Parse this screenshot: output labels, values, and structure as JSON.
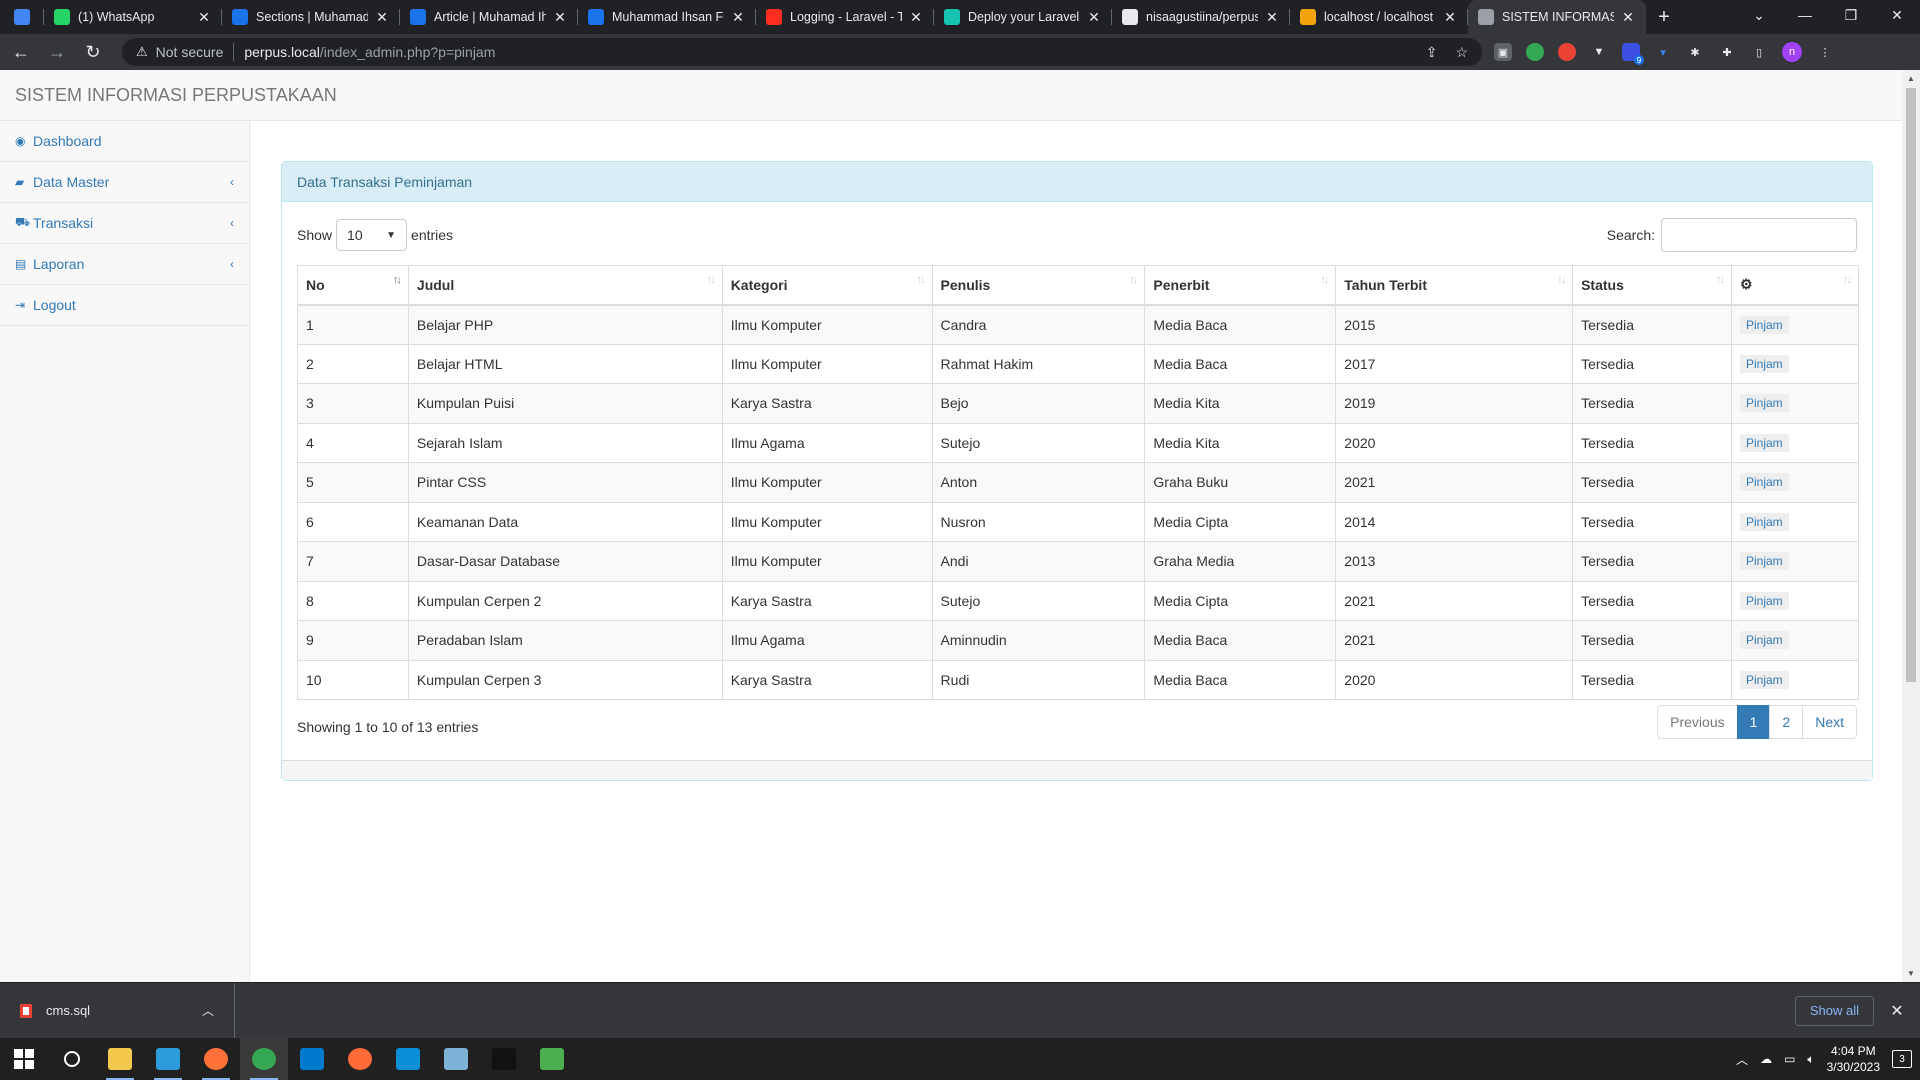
{
  "browser": {
    "tabs": [
      {
        "title": "",
        "icon": "pin-icon",
        "color": "#4285f4",
        "small": true
      },
      {
        "title": "(1) WhatsApp",
        "icon": "whatsapp-icon",
        "color": "#25d366"
      },
      {
        "title": "Sections | Muhamad",
        "icon": "edge-icon",
        "color": "#1a73e8"
      },
      {
        "title": "Article | Muhamad Ih",
        "icon": "edge-icon",
        "color": "#1a73e8"
      },
      {
        "title": "Muhammad Ihsan Fir",
        "icon": "letter-f-icon",
        "color": "#1a73e8"
      },
      {
        "title": "Logging - Laravel - Th",
        "icon": "laravel-icon",
        "color": "#ff2d20"
      },
      {
        "title": "Deploy your Laravel F",
        "icon": "fly-icon",
        "color": "#17c3b2"
      },
      {
        "title": "nisaagustiina/perpus",
        "icon": "github-icon",
        "color": "#e8eaed"
      },
      {
        "title": "localhost / localhost",
        "icon": "phpmyadmin-icon",
        "color": "#f0a30a"
      },
      {
        "title": "SISTEM INFORMASI P",
        "icon": "globe-icon",
        "color": "#9aa0a6",
        "active": true
      }
    ],
    "new_tab": "+",
    "address": {
      "security": "Not secure",
      "host": "perpus.local",
      "path": "/index_admin.php?p=pinjam"
    },
    "profile_initial": "n",
    "ext_badge": "9"
  },
  "app": {
    "brand": "SISTEM INFORMASI PERPUSTAKAAN",
    "sidebar": [
      {
        "label": "Dashboard",
        "icon": "dashboard-icon",
        "glyph": "◉",
        "expandable": false
      },
      {
        "label": "Data Master",
        "icon": "book-icon",
        "glyph": "▰",
        "expandable": true
      },
      {
        "label": "Transaksi",
        "icon": "cart-icon",
        "glyph": "⛟",
        "expandable": true
      },
      {
        "label": "Laporan",
        "icon": "list-icon",
        "glyph": "▤",
        "expandable": true
      },
      {
        "label": "Logout",
        "icon": "logout-icon",
        "glyph": "⇥",
        "expandable": false
      }
    ],
    "panel_title": "Data Transaksi Peminjaman",
    "length": {
      "show": "Show",
      "value": "10",
      "entries": "entries"
    },
    "search_label": "Search:",
    "search_value": "",
    "columns": [
      "No",
      "Judul",
      "Kategori",
      "Penulis",
      "Penerbit",
      "Tahun Terbit",
      "Status",
      ""
    ],
    "settings_column_icon": "gear-icon",
    "action_label": "Pinjam",
    "rows": [
      [
        "1",
        "Belajar PHP",
        "Ilmu Komputer",
        "Candra",
        "Media Baca",
        "2015",
        "Tersedia"
      ],
      [
        "2",
        "Belajar HTML",
        "Ilmu Komputer",
        "Rahmat Hakim",
        "Media Baca",
        "2017",
        "Tersedia"
      ],
      [
        "3",
        "Kumpulan Puisi",
        "Karya Sastra",
        "Bejo",
        "Media Kita",
        "2019",
        "Tersedia"
      ],
      [
        "4",
        "Sejarah Islam",
        "Ilmu Agama",
        "Sutejo",
        "Media Kita",
        "2020",
        "Tersedia"
      ],
      [
        "5",
        "Pintar CSS",
        "Ilmu Komputer",
        "Anton",
        "Graha Buku",
        "2021",
        "Tersedia"
      ],
      [
        "6",
        "Keamanan Data",
        "Ilmu Komputer",
        "Nusron",
        "Media Cipta",
        "2014",
        "Tersedia"
      ],
      [
        "7",
        "Dasar-Dasar Database",
        "Ilmu Komputer",
        "Andi",
        "Graha Media",
        "2013",
        "Tersedia"
      ],
      [
        "8",
        "Kumpulan Cerpen 2",
        "Karya Sastra",
        "Sutejo",
        "Media Cipta",
        "2021",
        "Tersedia"
      ],
      [
        "9",
        "Peradaban Islam",
        "Ilmu Agama",
        "Aminnudin",
        "Media Baca",
        "2021",
        "Tersedia"
      ],
      [
        "10",
        "Kumpulan Cerpen 3",
        "Karya Sastra",
        "Rudi",
        "Media Baca",
        "2020",
        "Tersedia"
      ]
    ],
    "info": "Showing 1 to 10 of 13 entries",
    "pagination": {
      "previous": "Previous",
      "pages": [
        "1",
        "2"
      ],
      "current": "1",
      "next": "Next"
    }
  },
  "downloads": {
    "file": "cms.sql",
    "show_all": "Show all"
  },
  "taskbar": {
    "apps": [
      {
        "name": "search-icon",
        "color": "#202020"
      },
      {
        "name": "file-explorer-icon",
        "color": "#f2c94c"
      },
      {
        "name": "network-app-icon",
        "color": "#2d9cdb"
      },
      {
        "name": "firefox-icon",
        "color": "#ff7139"
      },
      {
        "name": "chrome-icon",
        "color": "#34a853",
        "active": true
      },
      {
        "name": "vscode-icon",
        "color": "#007acc"
      },
      {
        "name": "postman-icon",
        "color": "#ff6c37"
      },
      {
        "name": "edge-icon",
        "color": "#0c8fd6"
      },
      {
        "name": "notes-icon",
        "color": "#7fb3d5"
      },
      {
        "name": "terminal-icon",
        "color": "#111111"
      },
      {
        "name": "notepad-icon",
        "color": "#4caf50"
      }
    ],
    "time": "4:04 PM",
    "date": "3/30/2023",
    "notifications": "3"
  }
}
